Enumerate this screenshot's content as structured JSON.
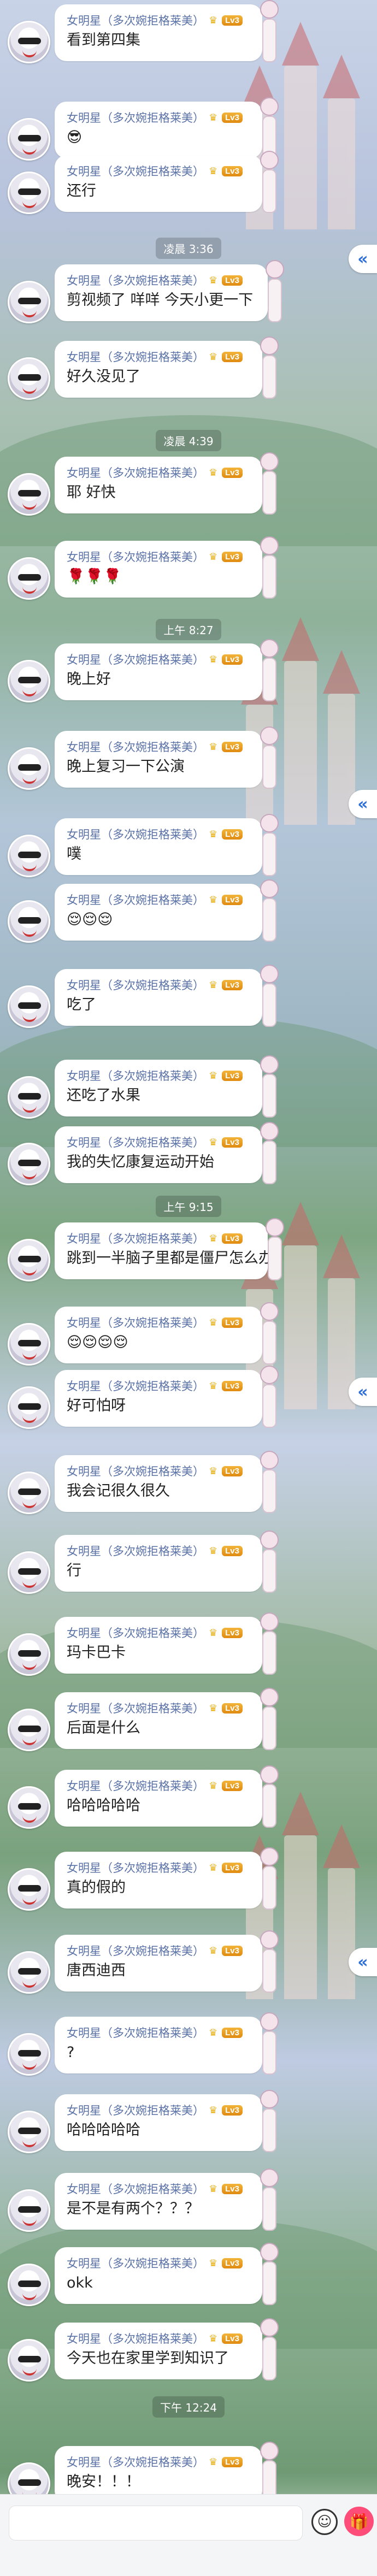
{
  "sender_name": "女明星（多次婉拒格莱美）",
  "level": "Lv3",
  "timestamps": [
    "凌晨 3:36",
    "凌晨 4:39",
    "上午 8:27",
    "上午 9:15",
    "下午 12:24"
  ],
  "messages": [
    {
      "text": "看到第四集"
    },
    {
      "text": "😎"
    },
    {
      "text": "还行"
    },
    {
      "text": "剪视频了 咩咩 今天小更一下"
    },
    {
      "text": "好久没见了"
    },
    {
      "text": "耶 好快"
    },
    {
      "text": "🌹🌹🌹"
    },
    {
      "text": "晚上好"
    },
    {
      "text": "晚上复习一下公演"
    },
    {
      "text": "噗"
    },
    {
      "text": "😌😌😌"
    },
    {
      "text": "吃了"
    },
    {
      "text": "还吃了水果"
    },
    {
      "text": "我的失忆康复运动开始"
    },
    {
      "text": "跳到一半脑子里都是僵尸怎么办"
    },
    {
      "text": "😌😌😌😌"
    },
    {
      "text": "好可怕呀"
    },
    {
      "text": "我会记很久很久"
    },
    {
      "text": "行"
    },
    {
      "text": "玛卡巴卡"
    },
    {
      "text": "后面是什么"
    },
    {
      "text": "哈哈哈哈哈"
    },
    {
      "text": "真的假的"
    },
    {
      "text": "唐西迪西"
    },
    {
      "text": "?"
    },
    {
      "text": "哈哈哈哈哈"
    },
    {
      "text": "是不是有两个？？？"
    },
    {
      "text": "okk"
    },
    {
      "text": "今天也在家里学到知识了"
    },
    {
      "text": "晚安！！！"
    }
  ],
  "icons": {
    "crown": "crown-icon",
    "collapse": "double-chevron-left-icon",
    "emoji": "emoji-face-icon",
    "gift": "gift-icon"
  },
  "colors": {
    "sender": "#5a72a6",
    "badge": "#f2b43a",
    "arrow": "#2e6fd8",
    "gift": "#ff4d79"
  }
}
